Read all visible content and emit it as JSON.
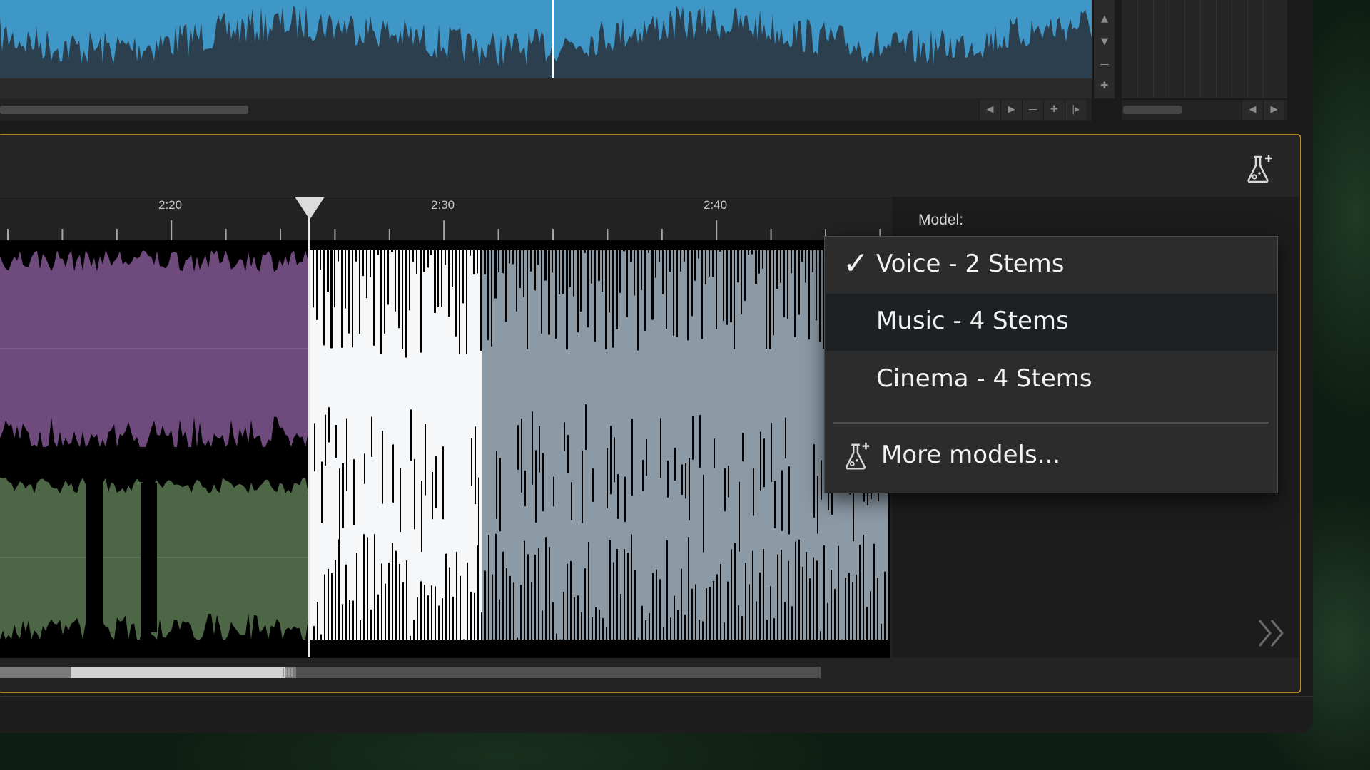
{
  "ruler": {
    "ticks": [
      "2:20",
      "2:30",
      "2:40"
    ]
  },
  "model": {
    "label": "Model:",
    "options": [
      "Voice - 2 Stems",
      "Music - 4 Stems",
      "Cinema - 4 Stems"
    ],
    "selected": "Voice - 2 Stems",
    "more_label": "More models..."
  },
  "colors": {
    "overview_wave": "#3f97c7",
    "vocal_stem": "#7a4f86",
    "music_stem": "#4f6b46",
    "panel_border": "#b08a2e"
  },
  "icons": {
    "lab": "flask-sparkle-icon",
    "expand": "double-chevron-right-icon",
    "check": "checkmark-icon"
  }
}
